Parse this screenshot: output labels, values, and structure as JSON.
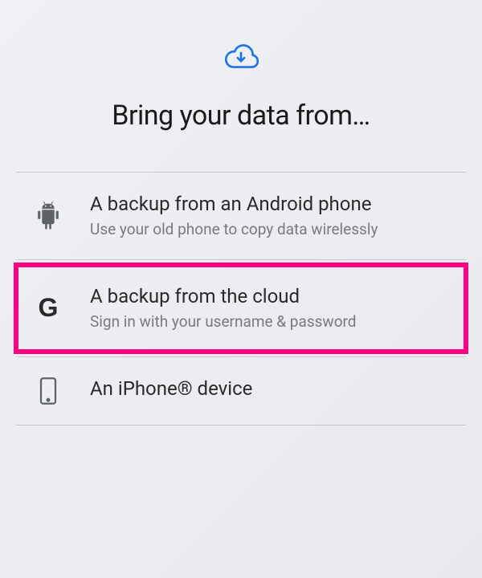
{
  "header": {
    "title": "Bring your data from…"
  },
  "options": [
    {
      "title": "A backup from an Android phone",
      "subtitle": "Use your old phone to copy data wirelessly"
    },
    {
      "title": "A backup from the cloud",
      "subtitle": "Sign in with your username & password"
    },
    {
      "title": "An iPhone® device",
      "subtitle": ""
    }
  ],
  "colors": {
    "accent": "#1a73e8",
    "highlight": "#ff0080"
  }
}
